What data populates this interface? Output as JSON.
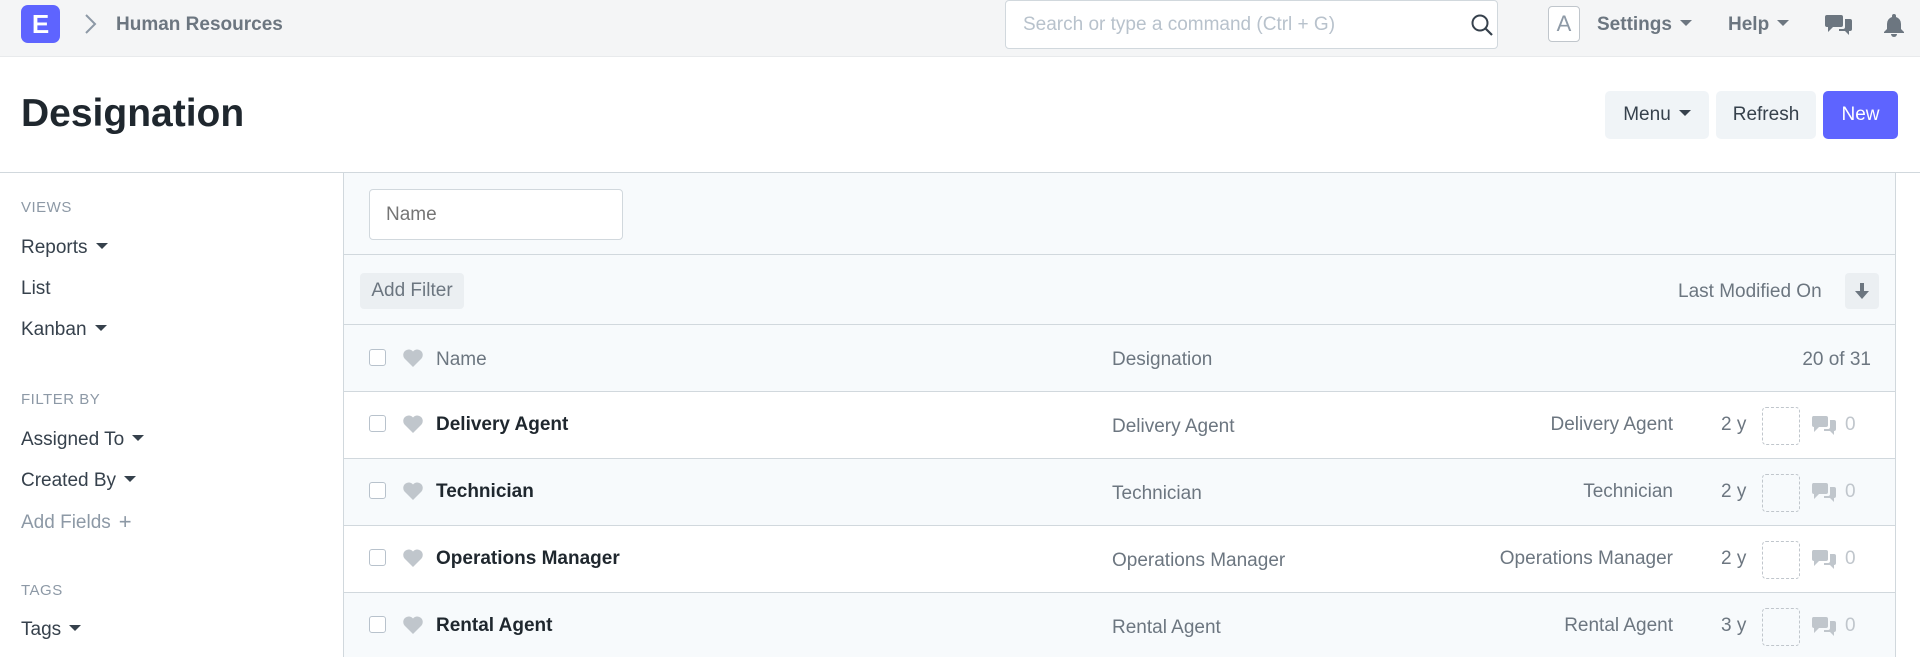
{
  "navbar": {
    "logo_letter": "E",
    "breadcrumb": "Human Resources",
    "search_placeholder": "Search or type a command (Ctrl + G)",
    "avatar_letter": "A",
    "settings_label": "Settings",
    "help_label": "Help",
    "icons": [
      "chevron-right-icon",
      "search-icon",
      "chat-icon",
      "bell-icon"
    ]
  },
  "page": {
    "title": "Designation",
    "menu_label": "Menu",
    "refresh_label": "Refresh",
    "new_label": "New"
  },
  "sidebar": {
    "views_heading": "VIEWS",
    "views": [
      "Reports",
      "List",
      "Kanban"
    ],
    "filter_heading": "FILTER BY",
    "filters": [
      "Assigned To",
      "Created By"
    ],
    "add_fields_label": "Add Fields",
    "tags_heading": "TAGS",
    "tags_label": "Tags"
  },
  "list": {
    "name_placeholder": "Name",
    "add_filter_label": "Add Filter",
    "sort_label": "Last Modified On",
    "columns": {
      "name": "Name",
      "designation": "Designation"
    },
    "count": "20 of 31",
    "rows": [
      {
        "name": "Delivery Agent",
        "designation": "Delivery Agent",
        "designation2": "Delivery Agent",
        "age": "2 y",
        "comments": "0"
      },
      {
        "name": "Technician",
        "designation": "Technician",
        "designation2": "Technician",
        "age": "2 y",
        "comments": "0"
      },
      {
        "name": "Operations Manager",
        "designation": "Operations Manager",
        "designation2": "Operations Manager",
        "age": "2 y",
        "comments": "0"
      },
      {
        "name": "Rental Agent",
        "designation": "Rental Agent",
        "designation2": "Rental Agent",
        "age": "3 y",
        "comments": "0"
      }
    ]
  },
  "colors": {
    "primary": "#5e64ff",
    "navbar_bg": "#f4f5f6",
    "text_dark": "#1f272e",
    "text_muted": "#6c7680",
    "border": "#d1d8dd"
  }
}
